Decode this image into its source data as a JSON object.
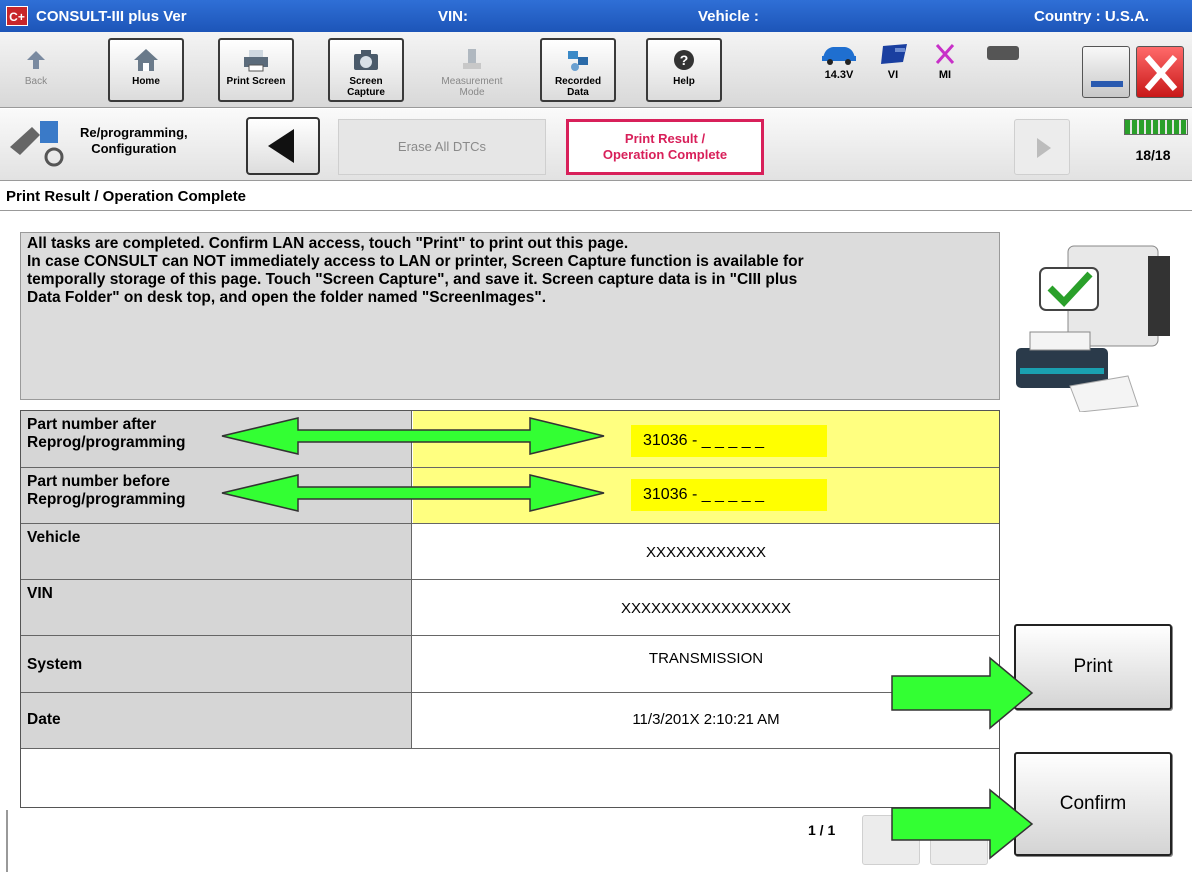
{
  "titlebar": {
    "logo": "C+",
    "app_name": "CONSULT-III plus  Ver",
    "vin_label": "VIN:",
    "vehicle_label": "Vehicle :",
    "country": "Country : U.S.A."
  },
  "toolbar": {
    "back": "Back",
    "home": "Home",
    "print_screen": "Print Screen",
    "screen_capture_1": "Screen",
    "screen_capture_2": "Capture",
    "measurement_1": "Measurement",
    "measurement_2": "Mode",
    "recorded_1": "Recorded",
    "recorded_2": "Data",
    "help": "Help",
    "voltage": "14.3V",
    "vi": "VI",
    "mi": "MI"
  },
  "nav": {
    "step_label_1": "Re/programming,",
    "step_label_2": "Configuration",
    "crumb_prev": "Erase All DTCs",
    "crumb_active_1": "Print Result /",
    "crumb_active_2": "Operation Complete",
    "progress_count": "18/18"
  },
  "page": {
    "title": "Print Result / Operation Complete",
    "message": [
      "All tasks are completed. Confirm LAN access, touch \"Print\" to print out this page.",
      "In case CONSULT can NOT immediately access to LAN or printer, Screen Capture function is available for",
      "temporally storage of this page. Touch \"Screen Capture\", and save it. Screen capture data is in \"CIII plus",
      "Data Folder\" on desk top, and open the folder named \"ScreenImages\"."
    ]
  },
  "results": {
    "rows": [
      {
        "label_1": "Part number after",
        "label_2": "Reprog/programming",
        "value": "31036 - _ _ _ _ _"
      },
      {
        "label_1": "Part number before",
        "label_2": "Reprog/programming",
        "value": "31036 - _ _ _ _ _"
      },
      {
        "label_1": "Vehicle",
        "label_2": "",
        "value": "XXXXXXXXXXXX"
      },
      {
        "label_1": "VIN",
        "label_2": "",
        "value": "XXXXXXXXXXXXXXXXX"
      },
      {
        "label_1": "System",
        "label_2": "",
        "value": "TRANSMISSION"
      },
      {
        "label_1": "Date",
        "label_2": "",
        "value": "11/3/201X 2:10:21 AM"
      }
    ]
  },
  "buttons": {
    "print": "Print",
    "confirm": "Confirm"
  },
  "pagination": {
    "indicator": "1 / 1"
  },
  "colors": {
    "titlebar": "#1d55b8",
    "active_crumb": "#d8205a",
    "highlight_yellow": "#ffff00",
    "arrow_green": "#33ff33"
  }
}
